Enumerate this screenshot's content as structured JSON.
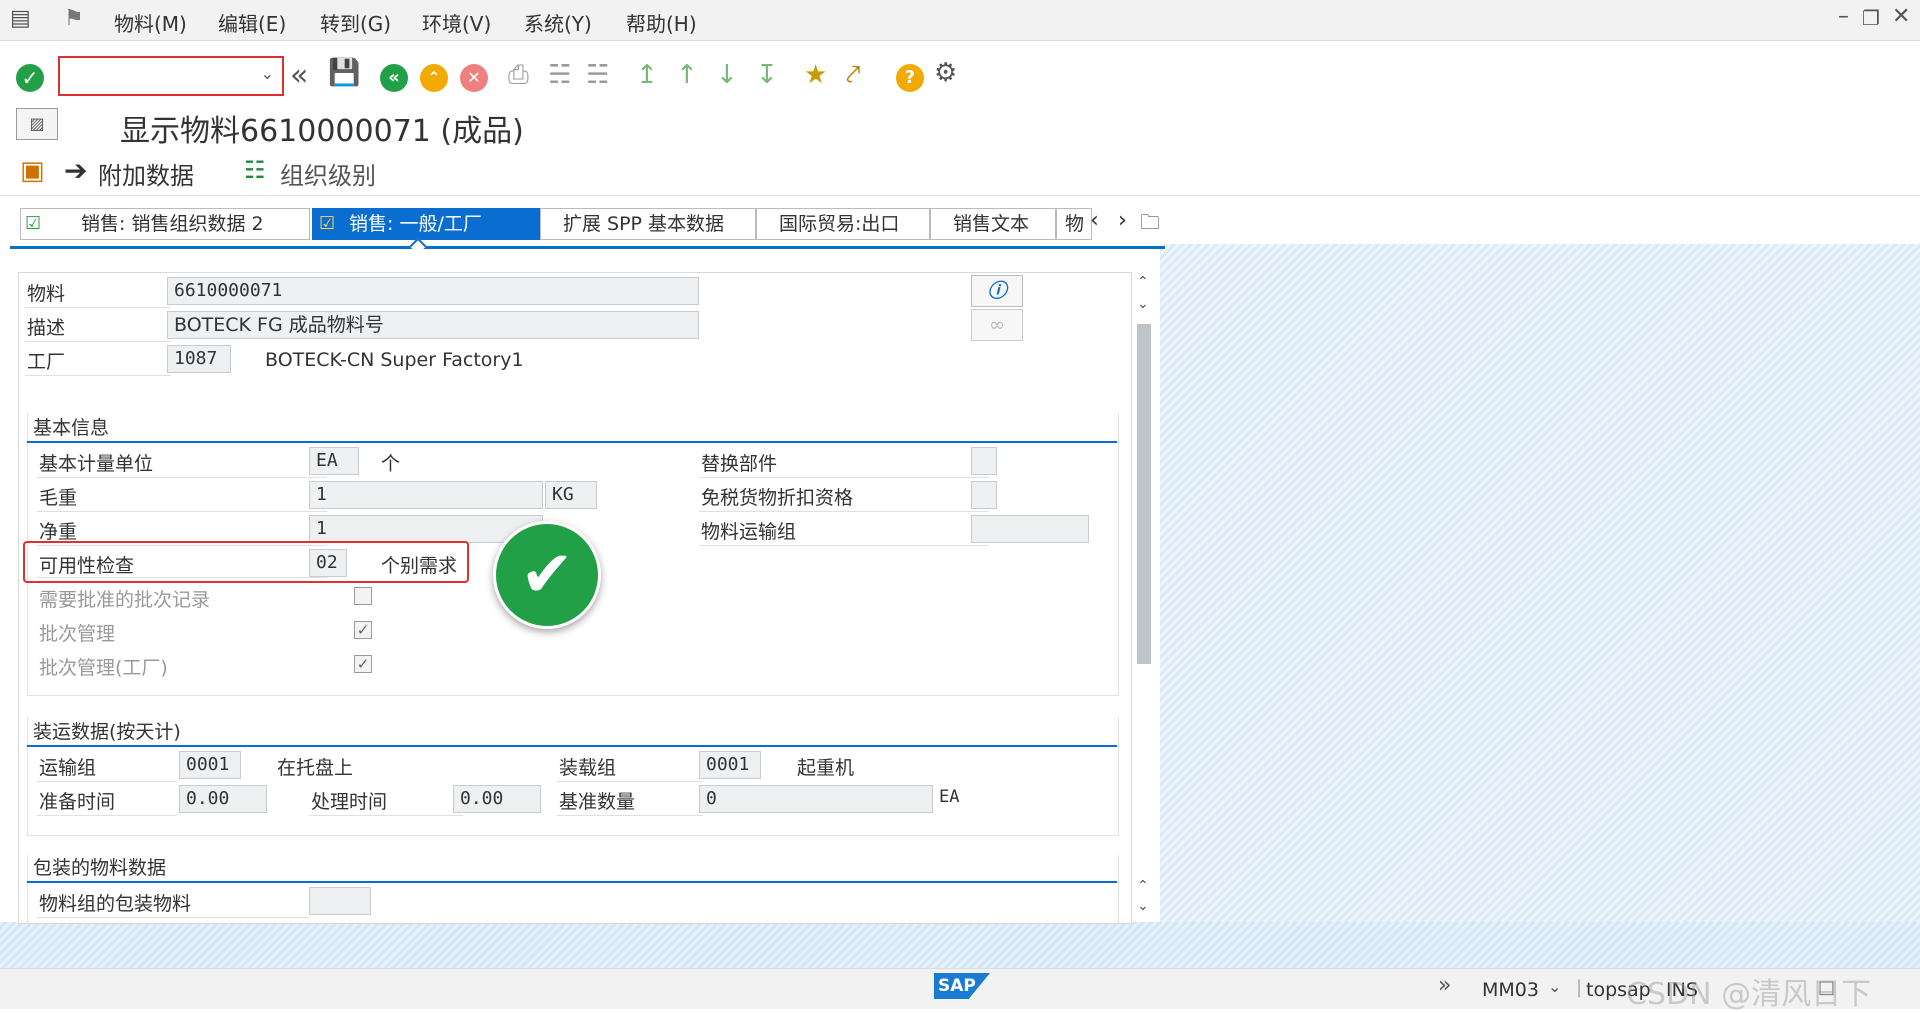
{
  "menubar": {
    "items": [
      "物料(M)",
      "编辑(E)",
      "转到(G)",
      "环境(V)",
      "系统(Y)",
      "帮助(H)"
    ]
  },
  "toolbar": {
    "command_value": ""
  },
  "title": "显示物料6610000071 (成品)",
  "app_toolbar": {
    "additional_data": "附加数据",
    "org_levels": "组织级别"
  },
  "tabs": [
    {
      "label": "销售: 销售组织数据 2",
      "active": false
    },
    {
      "label": "销售: 一般/工厂",
      "active": true
    },
    {
      "label": "扩展 SPP 基本数据",
      "active": false
    },
    {
      "label": "国际贸易:出口",
      "active": false
    },
    {
      "label": "销售文本",
      "active": false
    },
    {
      "label": "物",
      "active": false
    }
  ],
  "header": {
    "material_label": "物料",
    "material_value": "6610000071",
    "description_label": "描述",
    "description_value": "BOTECK FG 成品物料号",
    "plant_label": "工厂",
    "plant_value": "1087",
    "plant_name": "BOTECK-CN Super Factory1"
  },
  "basic_info": {
    "title": "基本信息",
    "base_uom_label": "基本计量单位",
    "base_uom_value": "EA",
    "base_uom_text": "个",
    "gross_weight_label": "毛重",
    "gross_weight_value": "1",
    "weight_unit": "KG",
    "net_weight_label": "净重",
    "net_weight_value": "1",
    "availability_label": "可用性检查",
    "availability_value": "02",
    "availability_text": "个别需求",
    "batch_record_label": "需要批准的批次记录",
    "batch_record_checked": false,
    "batch_mgmt_label": "批次管理",
    "batch_mgmt_checked": true,
    "batch_mgmt_plant_label": "批次管理(工厂)",
    "batch_mgmt_plant_checked": true,
    "replacement_part_label": "替换部件",
    "duty_free_label": "免税货物折扣资格",
    "transport_group_label": "物料运输组"
  },
  "shipping": {
    "title": "装运数据(按天计)",
    "trans_group_label": "运输组",
    "trans_group_value": "0001",
    "trans_group_text": "在托盘上",
    "loading_group_label": "装载组",
    "loading_group_value": "0001",
    "loading_group_text": "起重机",
    "setup_time_label": "准备时间",
    "setup_time_value": "0.00",
    "proc_time_label": "处理时间",
    "proc_time_value": "0.00",
    "base_qty_label": "基准数量",
    "base_qty_value": "0",
    "base_qty_unit": "EA"
  },
  "packaging": {
    "title": "包装的物料数据",
    "mat_group_pack_label": "物料组的包装物料"
  },
  "status": {
    "transaction": "MM03",
    "system": "topsap",
    "mode": "INS",
    "watermark": "CSDN @清风日下"
  },
  "colors": {
    "accent": "#0a6ed1",
    "ok_green": "#22a047",
    "sap_blue": "#1a7bd3",
    "highlight_red": "#e03030"
  }
}
